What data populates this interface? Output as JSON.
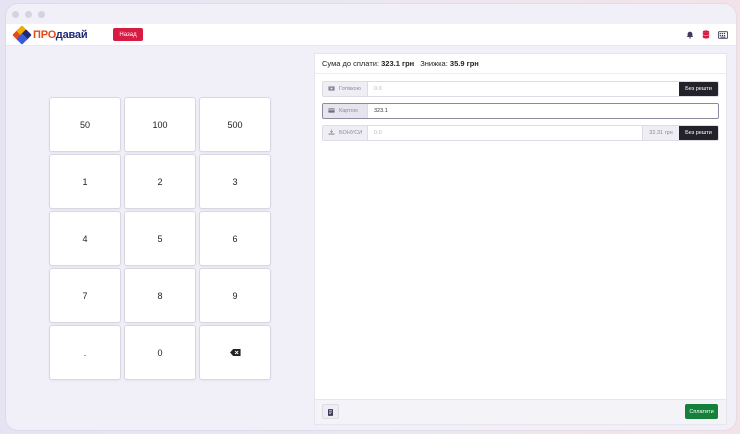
{
  "app": {
    "logo_pro": "ПРО",
    "logo_rest": "давай",
    "back_label": "Назад",
    "header_icons": [
      "bell-icon",
      "database-icon",
      "keyboard-icon"
    ],
    "colors": {
      "brand_red": "#d81b43",
      "brand_blue": "#1e2a78",
      "brand_orange": "#e64a19",
      "pay_green": "#14803c",
      "dark_button": "#23222b"
    }
  },
  "keypad": {
    "keys": [
      "50",
      "100",
      "500",
      "1",
      "2",
      "3",
      "4",
      "5",
      "6",
      "7",
      "8",
      "9",
      ".",
      "0",
      "backspace"
    ]
  },
  "summary": {
    "to_pay_label": "Сума до сплати:",
    "to_pay_value": "323.1 грн",
    "discount_label": "Знижка:",
    "discount_value": "35.9 грн"
  },
  "payments": {
    "cash": {
      "label": "Готівкою",
      "value": "0.0",
      "button": "Без решти"
    },
    "card": {
      "label": "Картою",
      "value": "323.1"
    },
    "bonus": {
      "label": "БОНУСИ",
      "value": "0.0",
      "available": "32.31 грн",
      "button": "Без решти"
    }
  },
  "footer": {
    "pay_button": "Сплатити"
  }
}
